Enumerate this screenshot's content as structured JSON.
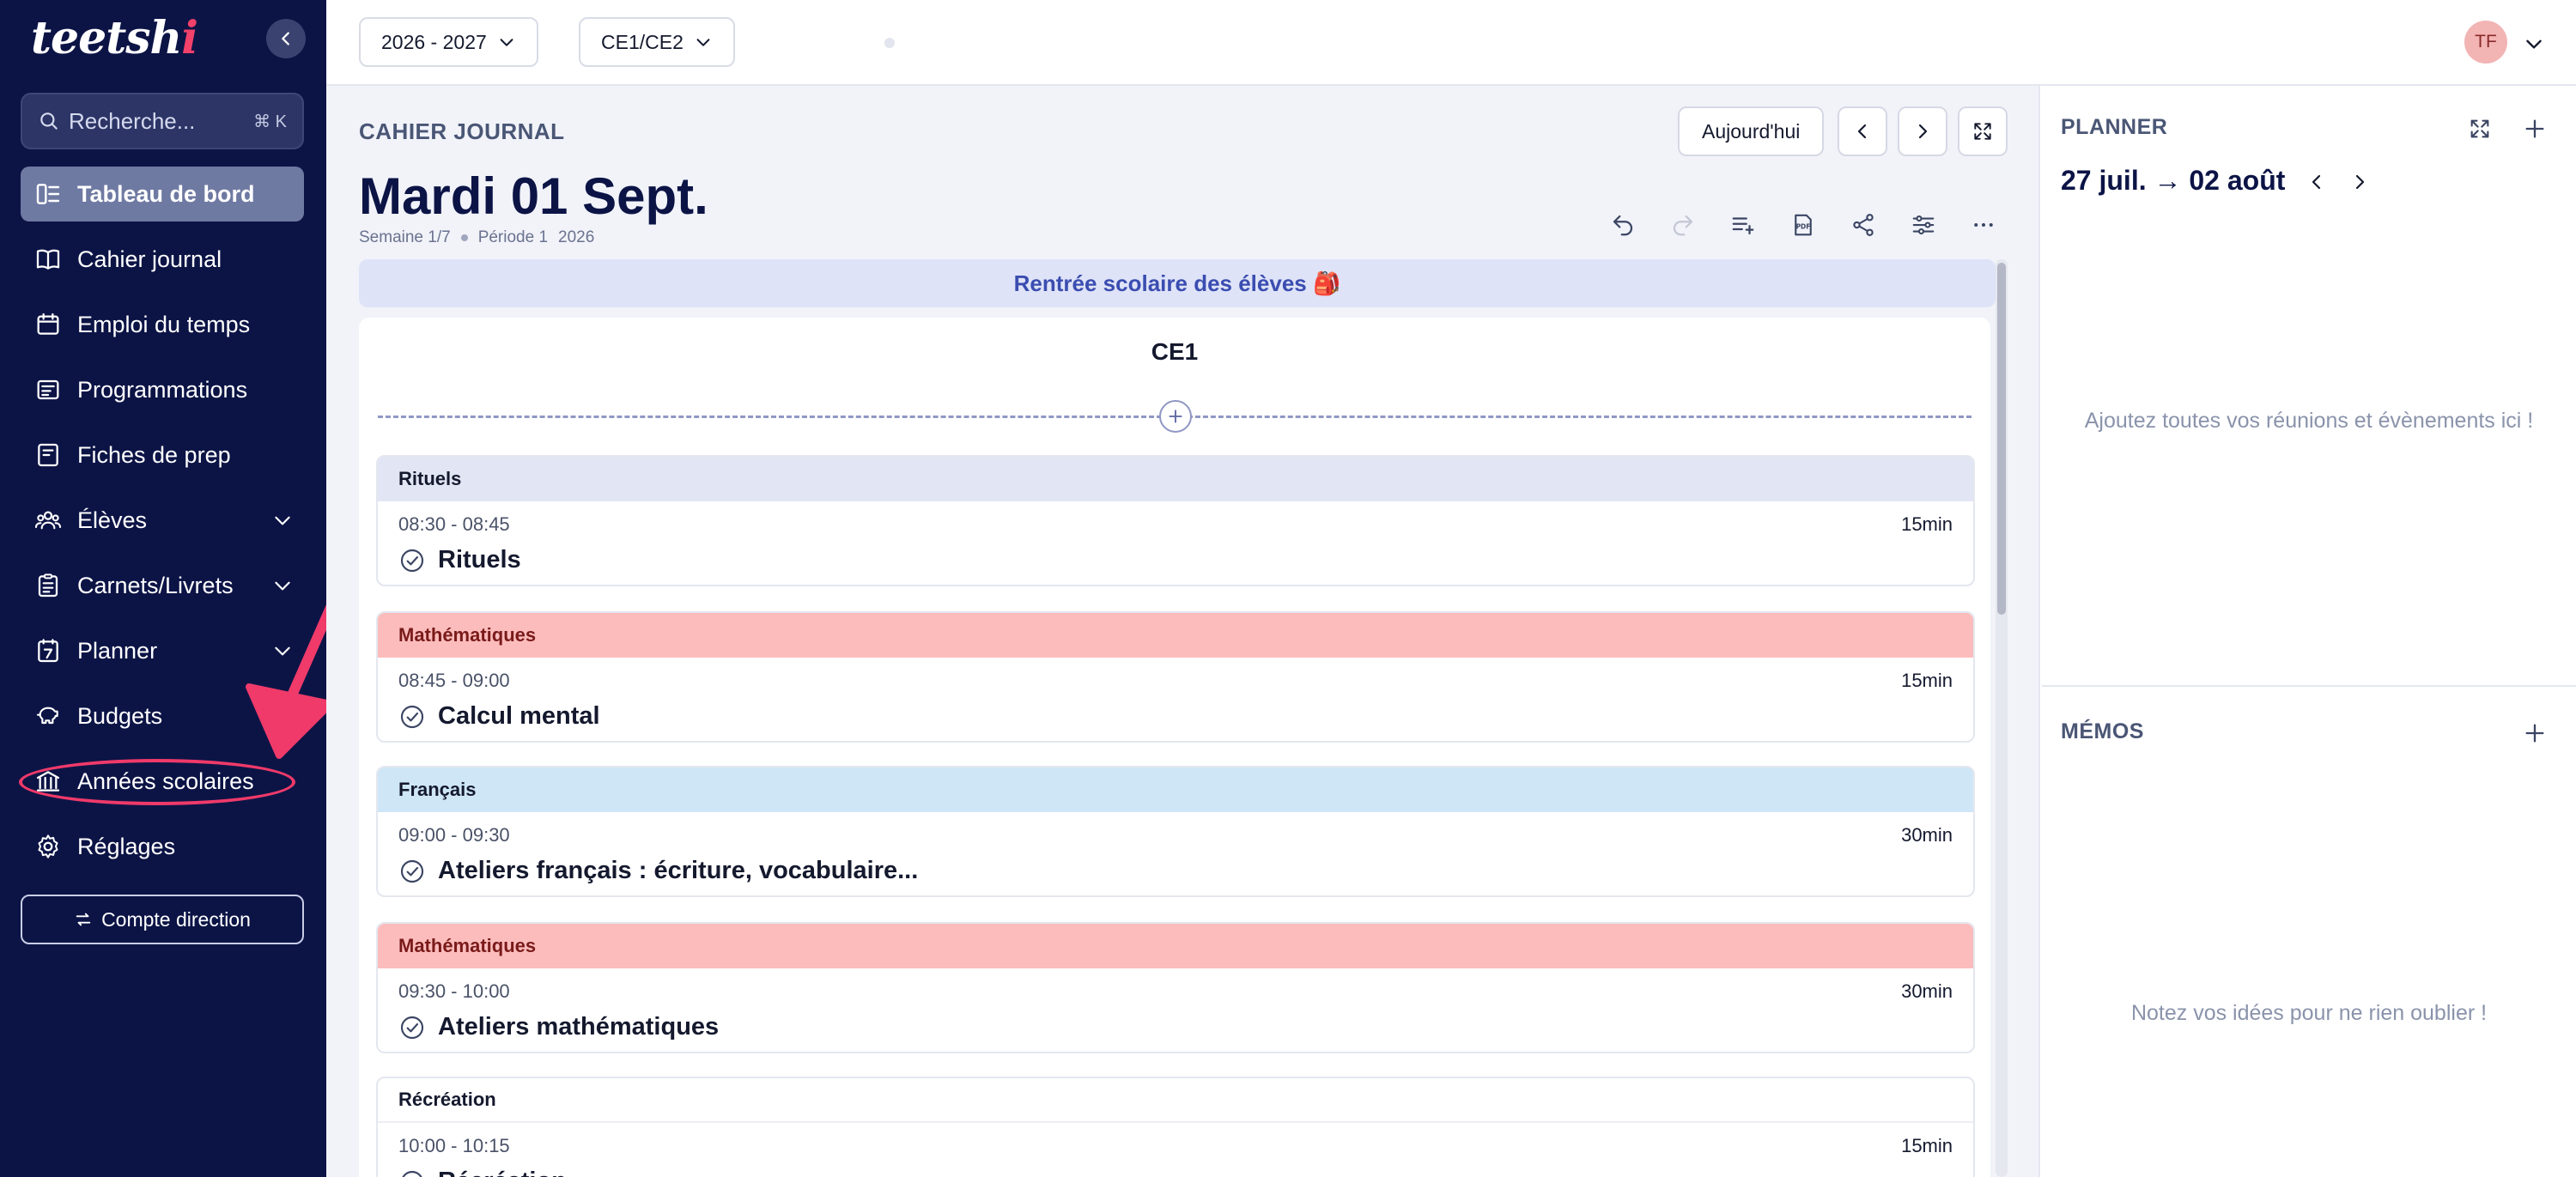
{
  "app": {
    "logo_text": "teetsh",
    "logo_accent": "i",
    "collapse_label": "‹"
  },
  "sidebar": {
    "search_placeholder": "Recherche...",
    "search_shortcut": "⌘ K",
    "items": [
      {
        "label": "Tableau de bord",
        "icon": "dashboard-icon",
        "active": true
      },
      {
        "label": "Cahier journal",
        "icon": "book-icon"
      },
      {
        "label": "Emploi du temps",
        "icon": "calendar-icon"
      },
      {
        "label": "Programmations",
        "icon": "list-icon"
      },
      {
        "label": "Fiches de prep",
        "icon": "document-icon"
      },
      {
        "label": "Élèves",
        "icon": "people-icon",
        "expandable": true
      },
      {
        "label": "Carnets/Livrets",
        "icon": "report-icon",
        "expandable": true
      },
      {
        "label": "Planner",
        "icon": "planner-icon",
        "expandable": true
      },
      {
        "label": "Budgets",
        "icon": "piggy-bank-icon"
      },
      {
        "label": "Années scolaires",
        "icon": "school-icon"
      },
      {
        "label": "Réglages",
        "icon": "gear-icon"
      }
    ],
    "direction_button": "Compte direction"
  },
  "topbar": {
    "year_select": "2026 - 2027",
    "class_select": "CE1/CE2",
    "user_initials": "TF"
  },
  "journal": {
    "section_title": "CAHIER JOURNAL",
    "day_title": "Mardi 01 Sept.",
    "week": "Semaine 1/7",
    "period": "Période 1",
    "year": "2026",
    "today_button": "Aujourd'hui",
    "event_banner": "Rentrée scolaire des élèves 🎒",
    "class_name": "CE1",
    "lessons": [
      {
        "subject": "Rituels",
        "time": "08:30 - 08:45",
        "duration": "15min",
        "title": "Rituels",
        "color": "#e2e6f4",
        "text_color": "#14192e"
      },
      {
        "subject": "Mathématiques",
        "time": "08:45 - 09:00",
        "duration": "15min",
        "title": "Calcul mental",
        "color": "#fcbcbc",
        "text_color": "#7a1a1a"
      },
      {
        "subject": "Français",
        "time": "09:00 - 09:30",
        "duration": "30min",
        "title": "Ateliers français : écriture, vocabulaire...",
        "color": "#cfe6f7",
        "text_color": "#14192e"
      },
      {
        "subject": "Mathématiques",
        "time": "09:30 - 10:00",
        "duration": "30min",
        "title": "Ateliers mathématiques",
        "color": "#fcbcbc",
        "text_color": "#7a1a1a"
      },
      {
        "subject": "Récréation",
        "time": "10:00 - 10:15",
        "duration": "15min",
        "title": "Récréation",
        "color": "#ffffff",
        "text_color": "#14192e"
      }
    ]
  },
  "planner": {
    "title": "PLANNER",
    "range": "27 juil. → 02 août",
    "empty": "Ajoutez toutes vos réunions et évènements ici !"
  },
  "memos": {
    "title": "MÉMOS",
    "empty": "Notez vos idées pour ne rien oublier !"
  }
}
